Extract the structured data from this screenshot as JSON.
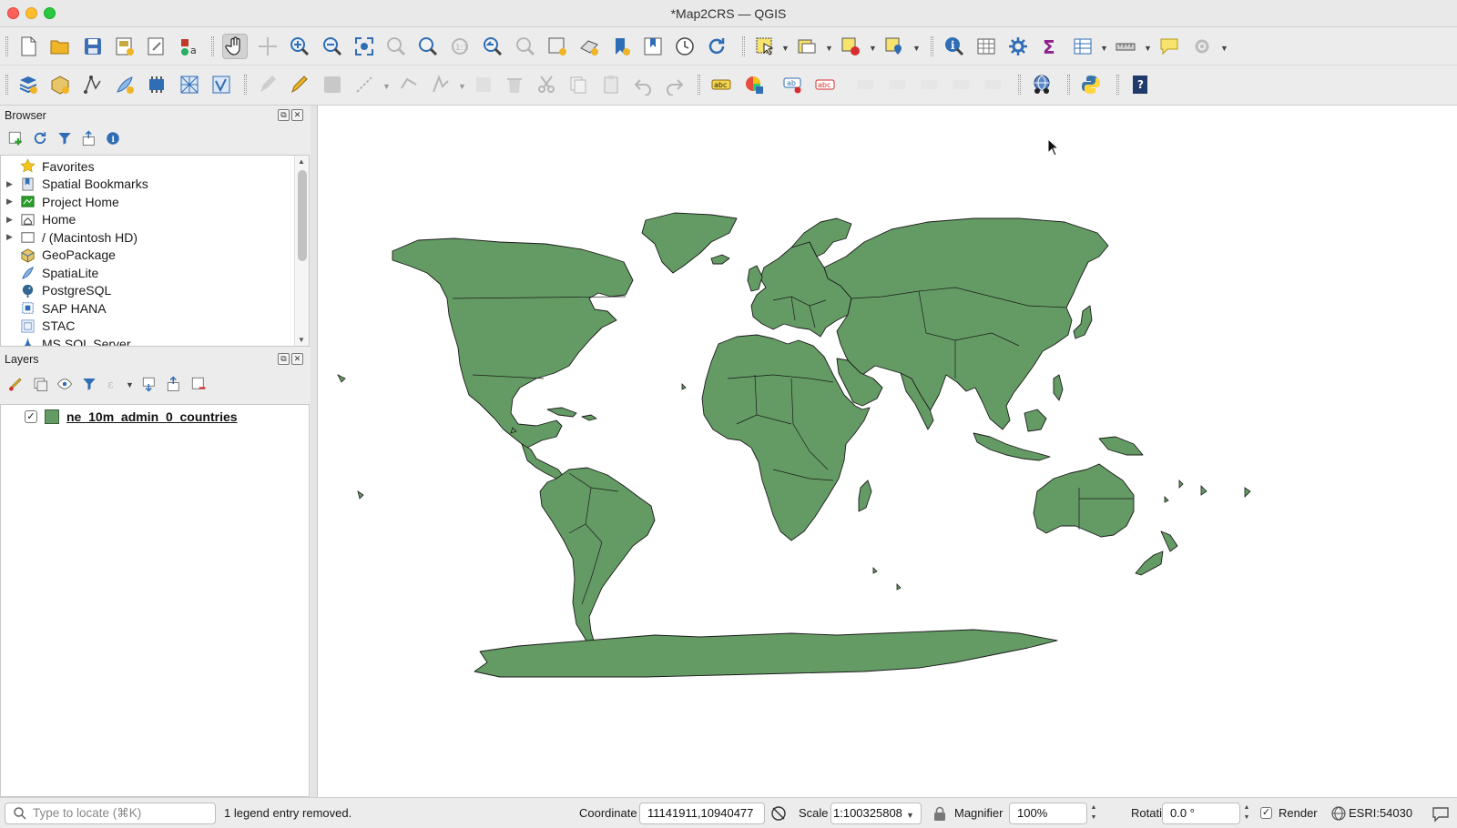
{
  "window": {
    "title": "*Map2CRS — QGIS"
  },
  "browser": {
    "title": "Browser",
    "items": [
      {
        "label": "Favorites",
        "icon": "star-icon",
        "expandable": false
      },
      {
        "label": "Spatial Bookmarks",
        "icon": "bookmark-icon",
        "expandable": true
      },
      {
        "label": "Project Home",
        "icon": "project-home-icon",
        "expandable": true
      },
      {
        "label": "Home",
        "icon": "home-folder-icon",
        "expandable": true
      },
      {
        "label": "/ (Macintosh HD)",
        "icon": "folder-icon",
        "expandable": true
      },
      {
        "label": "GeoPackage",
        "icon": "geopackage-icon",
        "expandable": false
      },
      {
        "label": "SpatiaLite",
        "icon": "spatialite-icon",
        "expandable": false
      },
      {
        "label": "PostgreSQL",
        "icon": "postgresql-icon",
        "expandable": false
      },
      {
        "label": "SAP HANA",
        "icon": "sap-hana-icon",
        "expandable": false
      },
      {
        "label": "STAC",
        "icon": "stac-icon",
        "expandable": false
      },
      {
        "label": "MS SQL Server",
        "icon": "mssql-icon",
        "expandable": false
      }
    ]
  },
  "layers": {
    "title": "Layers",
    "items": [
      {
        "name": "ne_10m_admin_0_countries",
        "visible": true,
        "color": "#649b64"
      }
    ]
  },
  "statusbar": {
    "locator_placeholder": "Type to locate (⌘K)",
    "message": "1 legend entry removed.",
    "coordinate_label": "Coordinate",
    "coordinate_value": "11141911,10940477",
    "scale_label": "Scale",
    "scale_value": "1:100325808",
    "magnifier_label": "Magnifier",
    "magnifier_value": "100%",
    "rotation_label": "Rotation",
    "rotation_value": "0.0 °",
    "render_label": "Render",
    "render_checked": true,
    "crs": "ESRI:54030"
  },
  "map": {
    "land_color": "#649b64",
    "outline_color": "#1a1a1a",
    "background": "#ffffff"
  }
}
